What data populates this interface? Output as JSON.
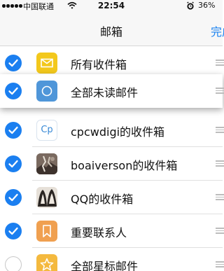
{
  "status": {
    "carrier": "中国联通",
    "time": "22:54",
    "battery": "36%"
  },
  "nav": {
    "title": "邮箱",
    "done": "完成"
  },
  "mailboxes": [
    {
      "label": "所有收件箱",
      "selected": true
    },
    {
      "label": "全部未读邮件",
      "selected": true
    },
    {
      "label": "cpcwdigi的收件箱",
      "icon_text": "Cp",
      "selected": true
    },
    {
      "label": "boaiverson的收件箱",
      "selected": true
    },
    {
      "label": "QQ的收件箱",
      "selected": true
    },
    {
      "label": "重要联系人",
      "selected": true
    },
    {
      "label": "全部星标邮件",
      "selected": false
    }
  ],
  "icons": [
    "inbox-icon",
    "unread-icon",
    "cp-avatar-icon",
    "boaiverson-avatar-icon",
    "qq-avatar-icon",
    "bookmark-icon",
    "star-icon"
  ],
  "colors": {
    "accent": "#1b7ff0",
    "inbox_yellow": "#f3c81c",
    "unread_blue": "#4f96d9",
    "important_orange": "#f0a050",
    "star_yellow": "#f4b93e"
  }
}
